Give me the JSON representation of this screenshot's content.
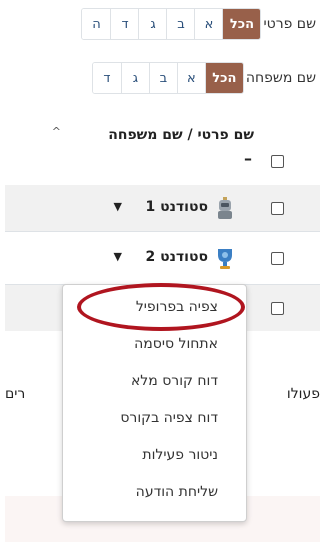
{
  "filters": {
    "first_name": {
      "label": "שם פרטי",
      "all": "הכל",
      "letters": [
        "א",
        "ב",
        "ג",
        "ד",
        "ה"
      ]
    },
    "last_name": {
      "label": "שם משפחה",
      "all": "הכל",
      "letters": [
        "א",
        "ב",
        "ג",
        "ד"
      ]
    }
  },
  "table": {
    "header": "שם פרטי / שם משפחה",
    "sort_indicator": "^",
    "dash": "–",
    "rows": [
      {
        "name": "סטודנט 1",
        "avatar": "robot-avatar-icon"
      },
      {
        "name": "סטודנט 2",
        "avatar": "trophy-avatar-icon"
      }
    ]
  },
  "context_menu": {
    "items": [
      "צפיה בפרופיל",
      "אתחול סיסמה",
      "דוח קורס מלא",
      "דוח צפיה בקורס",
      "ניטור פעילות",
      "שליחת הודעה"
    ],
    "highlighted": "צפיה בפרופיל",
    "highlight_color": "#b0151f"
  },
  "background_text": {
    "left_fragment": "רים",
    "right_fragment": "פעולו"
  },
  "colors": {
    "accent": "#98604a",
    "link": "#2a4f7a"
  }
}
